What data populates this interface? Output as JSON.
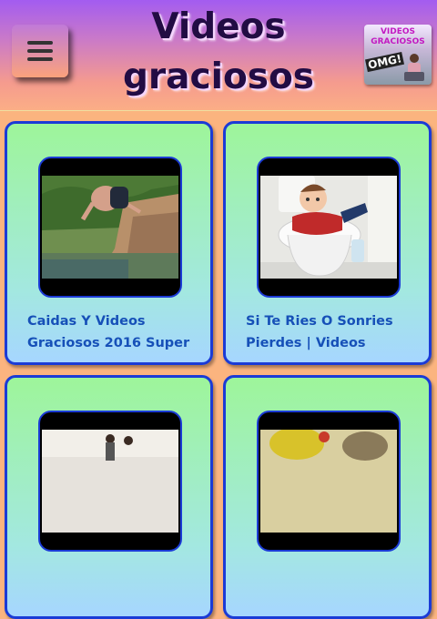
{
  "header": {
    "title_line1": "Videos",
    "title_line2": "graciosos",
    "menu_icon": "hamburger-menu-icon",
    "logo": {
      "line1": "VIDEOS",
      "line2": "GRACIOSOS",
      "badge": "OMG!"
    }
  },
  "videos": [
    {
      "title_line1": "Caidas Y Videos",
      "title_line2": "Graciosos 2016 Super"
    },
    {
      "title_line1": "Si Te Ries O Sonries",
      "title_line2": "Pierdes | Videos"
    },
    {
      "title_line1": "",
      "title_line2": ""
    },
    {
      "title_line1": "",
      "title_line2": ""
    }
  ],
  "colors": {
    "header_top": "#a35cf0",
    "header_bottom": "#fbae86",
    "card_border": "#1b3bd6",
    "card_title": "#1650b8",
    "page_background": "#fbb47f"
  }
}
